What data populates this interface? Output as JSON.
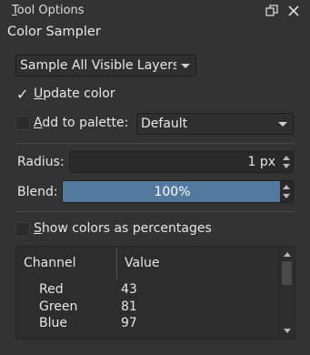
{
  "titlebar": {
    "title_first": "T",
    "title_rest": "ool Options"
  },
  "panel": {
    "title": "Color Sampler"
  },
  "sample_mode": {
    "value": "Sample All Visible Layers"
  },
  "update_color": {
    "checked": true,
    "label_first": "U",
    "label_rest": "pdate color"
  },
  "add_to_palette": {
    "checked": false,
    "label_first": "A",
    "label_rest": "dd to palette:",
    "palette_value": "Default"
  },
  "radius": {
    "label": "Radius:",
    "value": "1 px"
  },
  "blend": {
    "label": "Blend:",
    "value": "100%",
    "fill_fraction": 1.0,
    "fill_color": "#54799e"
  },
  "show_percentages": {
    "checked": false,
    "label_first": "S",
    "label_rest": "how colors as percentages"
  },
  "table": {
    "headers": [
      "Channel",
      "Value"
    ],
    "rows": [
      {
        "channel": "Red",
        "value": "43"
      },
      {
        "channel": "Green",
        "value": "81"
      },
      {
        "channel": "Blue",
        "value": "97"
      }
    ]
  }
}
